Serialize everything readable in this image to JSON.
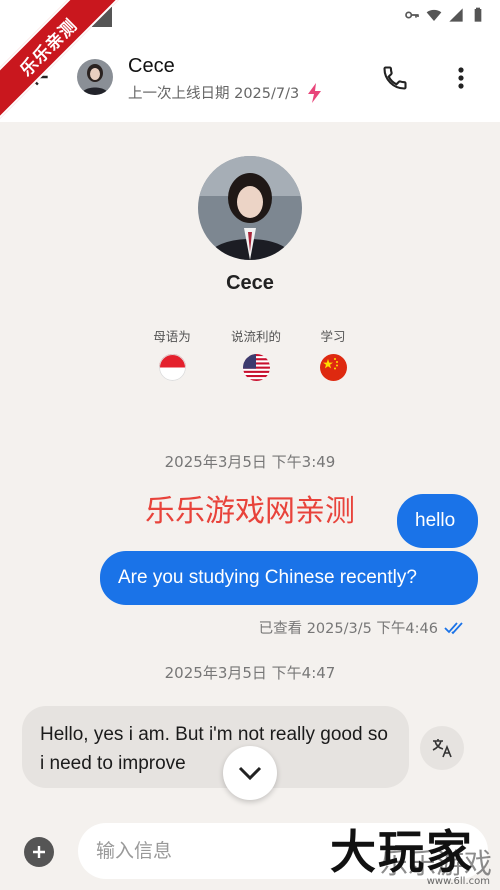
{
  "watermark": {
    "ribbon": "乐乐亲测",
    "overlay": "乐乐游戏网亲测",
    "corner_big": "大玩家",
    "corner_small": "乐乐游戏",
    "corner_url": "www.6ll.com"
  },
  "header": {
    "name": "Cece",
    "last_online": "上一次上线日期 2025/7/3",
    "icons": [
      "back-arrow-icon",
      "phone-icon",
      "more-vert-icon",
      "lightning-icon"
    ]
  },
  "profile": {
    "name": "Cece",
    "languages": [
      {
        "label": "母语为",
        "flag": "indonesia"
      },
      {
        "label": "说流利的",
        "flag": "united-states"
      },
      {
        "label": "学习",
        "flag": "china"
      }
    ]
  },
  "messages": {
    "date_1": "2025年3月5日 下午3:49",
    "out_1": "hello",
    "out_2": "Are you studying Chinese recently?",
    "seen": "已查看 2025/3/5 下午4:46",
    "date_2": "2025年3月5日 下午4:47",
    "in_1": "Hello, yes i am. But i'm not really good so i need to improve"
  },
  "composer": {
    "placeholder": "输入信息"
  },
  "colors": {
    "accent": "#1a73e8",
    "lightning": "#e8457a",
    "ribbon": "#c9171e"
  }
}
